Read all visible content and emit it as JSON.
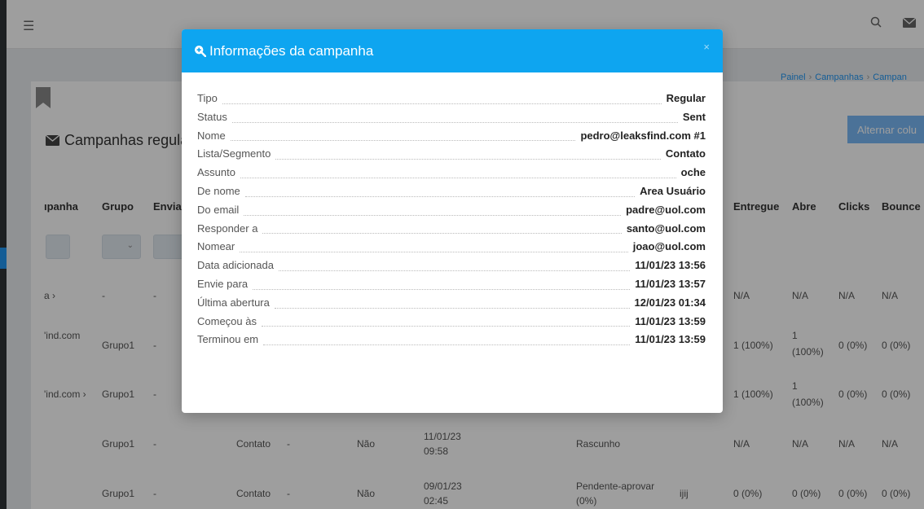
{
  "topbar": {
    "menu_icon": "menu-icon",
    "search_icon": "search-icon",
    "mail_icon": "mail-icon"
  },
  "breadcrumb": [
    "Painel",
    "Campanhas",
    "Campan"
  ],
  "page": {
    "title": "Campanhas regular",
    "toggle_button": "Alternar colu"
  },
  "table": {
    "headers": [
      "ıpanha",
      "Grupo",
      "Envia",
      "Entregue",
      "Abre",
      "Clicks",
      "Bounce"
    ],
    "rows": [
      {
        "campaign": "a ›",
        "group": "-",
        "dash": "-",
        "entregue": "N/A",
        "abre": "N/A",
        "clicks": "N/A",
        "bounce": "N/A"
      },
      {
        "campaign": "'ind.com",
        "group": "Grupo1",
        "dash": "-",
        "entregue": "1 (100%)",
        "abre_1": "1",
        "abre_2": "(100%)",
        "clicks": "0 (0%)",
        "bounce": "0 (0%)"
      },
      {
        "campaign": "'ind.com ›",
        "group": "Grupo1",
        "dash": "-",
        "entregue": "1 (100%)",
        "abre_1": "1",
        "abre_2": "(100%)",
        "clicks": "0 (0%)",
        "bounce": "0 (0%)"
      },
      {
        "group": "Grupo1",
        "dash": "-",
        "list": "Contato",
        "dash2": "-",
        "flag": "Não",
        "date_1": "11/01/23",
        "date_2": "09:58",
        "status": "Rascunho",
        "entregue": "N/A",
        "abre": "N/A",
        "clicks": "N/A",
        "bounce": "N/A"
      },
      {
        "group": "Grupo1",
        "dash": "-",
        "list": "Contato",
        "dash2": "-",
        "flag": "Não",
        "date_1": "09/01/23",
        "date_2": "02:45",
        "status_1": "Pendente-aprovar",
        "status_2": "(0%)",
        "extra": "ijij",
        "entregue": "0 (0%)",
        "abre": "0 (0%)",
        "clicks": "0 (0%)",
        "bounce": "0 (0%)"
      }
    ]
  },
  "modal": {
    "title": "Informações da campanha",
    "close": "×",
    "fields": [
      {
        "label": "Tipo",
        "value": "Regular"
      },
      {
        "label": "Status",
        "value": "Sent"
      },
      {
        "label": "Nome",
        "value": "pedro@leaksfind.com #1"
      },
      {
        "label": "Lista/Segmento",
        "value": "Contato"
      },
      {
        "label": "Assunto",
        "value": "oche"
      },
      {
        "label": "De nome",
        "value": "Area Usuário"
      },
      {
        "label": "Do email",
        "value": "padre@uol.com"
      },
      {
        "label": "Responder a",
        "value": "santo@uol.com"
      },
      {
        "label": "Nomear",
        "value": "joao@uol.com"
      },
      {
        "label": "Data adicionada",
        "value": "11/01/23 13:56"
      },
      {
        "label": "Envie para",
        "value": "11/01/23 13:57"
      },
      {
        "label": "Última abertura",
        "value": "12/01/23 01:34"
      },
      {
        "label": "Começou às",
        "value": "11/01/23 13:59"
      },
      {
        "label": "Terminou em",
        "value": "11/01/23 13:59"
      }
    ]
  }
}
